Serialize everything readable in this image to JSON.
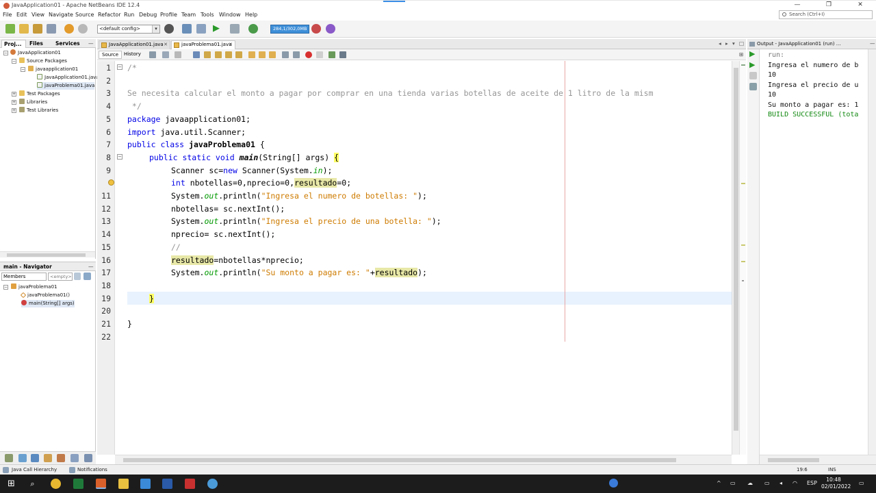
{
  "window": {
    "title": "JavaApplication01 - Apache NetBeans IDE 12.4",
    "minimize": "—",
    "maximize": "❐",
    "close": "✕"
  },
  "menu": [
    "File",
    "Edit",
    "View",
    "Navigate",
    "Source",
    "Refactor",
    "Run",
    "Debug",
    "Profile",
    "Team",
    "Tools",
    "Window",
    "Help"
  ],
  "search": {
    "placeholder": "Search (Ctrl+I)"
  },
  "toolbar": {
    "config": "<default config>",
    "memory": "284,1/302,0MB",
    "icons": [
      "new-project-icon",
      "new-file-icon",
      "open-project-icon",
      "save-all-icon",
      "undo-icon",
      "redo-icon",
      "globe-icon",
      "clean-build-icon",
      "build-icon",
      "run-icon",
      "debug-icon",
      "profile-icon",
      "gc-icon"
    ]
  },
  "projects": {
    "tabs": [
      "Proj...",
      "Files",
      "Services"
    ],
    "tree": [
      "JavaApplication01",
      "Source Packages",
      "javaapplication01",
      "JavaApplication01.java",
      "javaProblema01.java",
      "Test Packages",
      "Libraries",
      "Test Libraries"
    ]
  },
  "navigator": {
    "title": "main - Navigator",
    "filter": "Members",
    "empty": "<empty>",
    "tree": [
      "javaProblema01",
      "javaProblema01()",
      "main(String[] args)"
    ]
  },
  "editor": {
    "tabs": [
      "JavaApplication01.java",
      "javaProblema01.java"
    ],
    "source_tab": "Source",
    "history_tab": "History",
    "line_numbers": [
      "1",
      "2",
      "3",
      "4",
      "5",
      "6",
      "7",
      "8",
      "9",
      "10",
      "11",
      "12",
      "13",
      "14",
      "15",
      "16",
      "17",
      "18",
      "19",
      "20",
      "21",
      "22"
    ],
    "code": {
      "l1": "/*",
      "l3": "Se necesita calcular el monto a pagar por comprar en una tienda varias botellas de aceite de 1 litro de la mism",
      "l4": " */",
      "l5_kw": "package",
      "l5_rest": " javaapplication01;",
      "l6_kw": "import",
      "l6_rest": " java.util.Scanner;",
      "l7_kw": "public class",
      "l7_name": " javaProblema01",
      "l7_rest": " {",
      "l8_kw": "public static void",
      "l8_name": "main",
      "l8_rest": "(String[] args) ",
      "l8_brace": "{",
      "l9_a": "Scanner sc=",
      "l9_kw": "new",
      "l9_b": " Scanner(System.",
      "l9_field": "in",
      "l9_c": ");",
      "l10_kw": "int",
      "l10_a": " nbotellas=0,nprecio=0,",
      "l10_hl": "resultado",
      "l10_b": "=0;",
      "l11_a": "System.",
      "l11_field": "out",
      "l11_b": ".println(",
      "l11_str": "\"Ingresa el numero de botellas: \"",
      "l11_c": ");",
      "l12_a": "nbotellas= sc.nextInt();",
      "l13_a": "System.",
      "l13_field": "out",
      "l13_b": ".println(",
      "l13_str": "\"Ingresa el precio de una botella: \"",
      "l13_c": ");",
      "l14_a": "nprecio= sc.nextInt();",
      "l15_cm": "//",
      "l16_hl": "resultado",
      "l16_a": "=nbotellas*nprecio;",
      "l17_a": "System.",
      "l17_field": "out",
      "l17_b": ".println(",
      "l17_str": "\"Su monto a pagar es: \"",
      "l17_plus": "+",
      "l17_hl": "resultado",
      "l17_c": ");",
      "l19_brace": "}",
      "l21": "}"
    }
  },
  "output": {
    "title": "Output - JavaApplication01 (run) ...",
    "lines": [
      "run:",
      "Ingresa el numero de b",
      "10",
      "Ingresa el precio de u",
      "10",
      "Su monto a pagar es: 1",
      "BUILD SUCCESSFUL (tota"
    ]
  },
  "status": {
    "call_hierarchy": "Java Call Hierarchy",
    "notifications": "Notifications",
    "position": "19:6",
    "mode": "INS"
  },
  "taskbar": {
    "lang": "ESP",
    "time": "10:48",
    "date": "02/01/2022"
  }
}
